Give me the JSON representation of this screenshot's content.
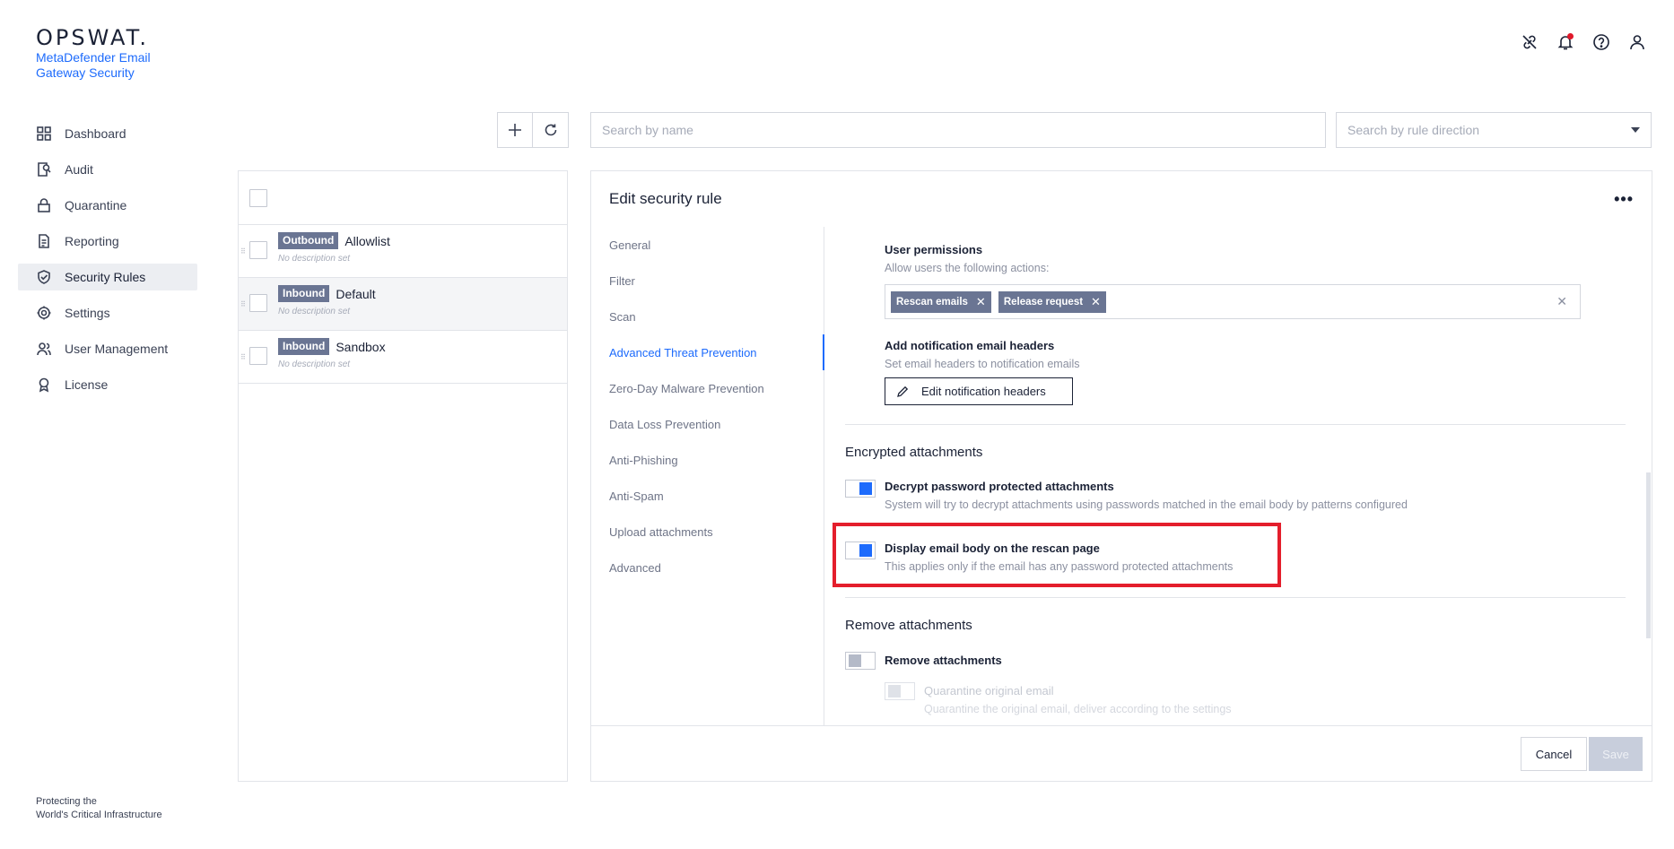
{
  "brand": {
    "logo": "OPSWAT.",
    "product": "MetaDefender Email Gateway Security",
    "footer_line1": "Protecting the",
    "footer_line2": "World's Critical Infrastructure"
  },
  "nav": {
    "items": [
      {
        "label": "Dashboard",
        "icon": "dashboard-icon"
      },
      {
        "label": "Audit",
        "icon": "audit-icon"
      },
      {
        "label": "Quarantine",
        "icon": "lock-icon"
      },
      {
        "label": "Reporting",
        "icon": "document-icon"
      },
      {
        "label": "Security Rules",
        "icon": "shield-check-icon",
        "active": true
      },
      {
        "label": "Settings",
        "icon": "gear-icon"
      },
      {
        "label": "User Management",
        "icon": "users-icon"
      },
      {
        "label": "License",
        "icon": "badge-icon"
      }
    ]
  },
  "header_icons": [
    "link-icon",
    "bell-icon",
    "help-icon",
    "user-icon"
  ],
  "toolbar": {
    "search_placeholder": "Search by name",
    "direction_placeholder": "Search by rule direction"
  },
  "rules": [
    {
      "badge": "Outbound",
      "name": "Allowlist",
      "desc": "No description set"
    },
    {
      "badge": "Inbound",
      "name": "Default",
      "desc": "No description set",
      "selected": true
    },
    {
      "badge": "Inbound",
      "name": "Sandbox",
      "desc": "No description set"
    }
  ],
  "edit": {
    "title": "Edit security rule",
    "more": "•••",
    "tabs": [
      "General",
      "Filter",
      "Scan",
      "Advanced Threat Prevention",
      "Zero-Day Malware Prevention",
      "Data Loss Prevention",
      "Anti-Phishing",
      "Anti-Spam",
      "Upload attachments",
      "Advanced"
    ],
    "active_tab": "Advanced Threat Prevention",
    "user_permissions": {
      "title": "User permissions",
      "desc": "Allow users the following actions:",
      "tags": [
        "Rescan emails",
        "Release request"
      ]
    },
    "notification_headers": {
      "title": "Add notification email headers",
      "desc": "Set email headers to notification emails",
      "button": "Edit notification headers"
    },
    "encrypted": {
      "section": "Encrypted attachments",
      "decrypt_title": "Decrypt password protected attachments",
      "decrypt_desc": "System will try to decrypt attachments using passwords matched in the email body by patterns configured",
      "decrypt_on": true,
      "display_title": "Display email body on the rescan page",
      "display_desc": "This applies only if the email has any password protected attachments",
      "display_on": true
    },
    "remove": {
      "section": "Remove attachments",
      "remove_title": "Remove attachments",
      "remove_on": false,
      "quarantine_title": "Quarantine original email",
      "quarantine_desc": "Quarantine the original email, deliver according to the settings"
    },
    "cancel": "Cancel",
    "save": "Save"
  },
  "colors": {
    "accent": "#1d6bfc",
    "badge": "#6a7593",
    "highlight": "#e41e2c"
  }
}
